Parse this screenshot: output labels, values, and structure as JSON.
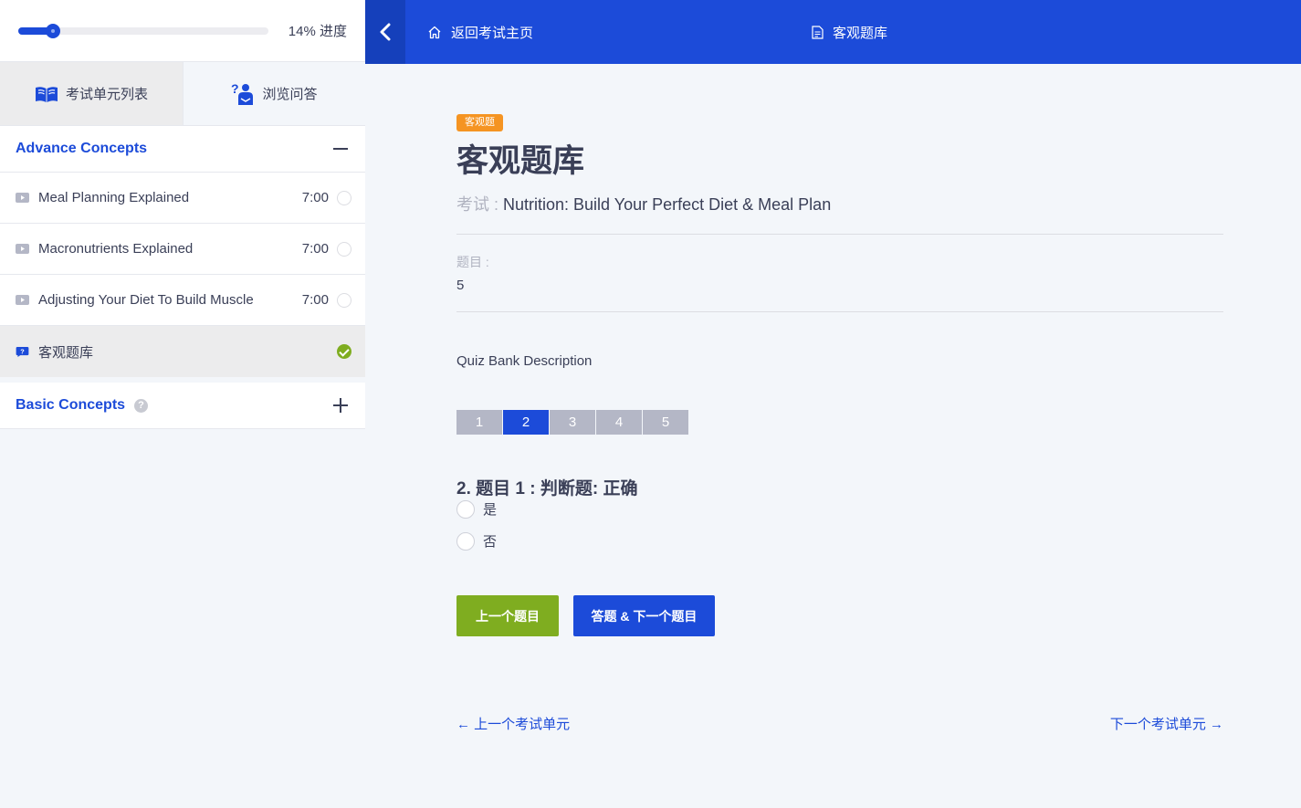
{
  "colors": {
    "brand": "#1c4bd9",
    "success": "#7fad20",
    "badge": "#f59422"
  },
  "sidebar": {
    "progress": {
      "percent": 14,
      "label": "14% 进度"
    },
    "tabs": [
      {
        "label": "考试单元列表",
        "icon": "book-icon"
      },
      {
        "label": "浏览问答",
        "icon": "question-person-icon"
      }
    ],
    "sections": [
      {
        "title": "Advance Concepts",
        "expanded": true,
        "lessons": [
          {
            "title": "Meal Planning Explained",
            "duration": "7:00",
            "icon": "video-icon",
            "done": false
          },
          {
            "title": "Macronutrients Explained",
            "duration": "7:00",
            "icon": "video-icon",
            "done": false
          },
          {
            "title": "Adjusting Your Diet To Build Muscle",
            "duration": "7:00",
            "icon": "video-icon",
            "done": false
          },
          {
            "title": "客观题库",
            "duration": "",
            "icon": "quiz-icon",
            "done": true
          }
        ]
      },
      {
        "title": "Basic Concepts",
        "expanded": false
      }
    ]
  },
  "topbar": {
    "back_label": "返回考试主页",
    "current_label": "客观题库"
  },
  "main": {
    "badge": "客观题",
    "title": "客观题库",
    "exam_label": "考试 : ",
    "exam_name": "Nutrition: Build Your Perfect Diet & Meal Plan",
    "questions_label": "题目 :",
    "questions_value": "5",
    "description": "Quiz Bank Description",
    "pages": [
      "1",
      "2",
      "3",
      "4",
      "5"
    ],
    "active_page": "2",
    "question": "2. 题目 1 : 判断题:  正确",
    "options": [
      "是",
      "否"
    ],
    "prev_button": "上一个题目",
    "next_button": "答题 & 下一个题目",
    "prev_unit": "← 上一个考试单元",
    "next_unit": "下一个考试单元 →"
  }
}
